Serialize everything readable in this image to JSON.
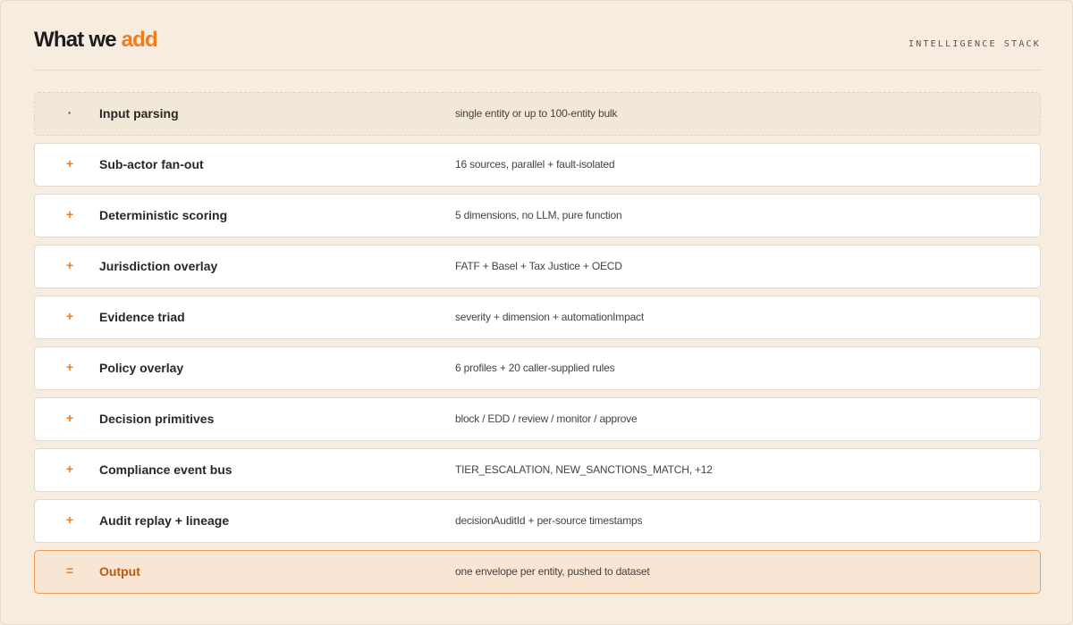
{
  "header": {
    "title_main": "What we",
    "title_accent": "add",
    "kicker": "INTELLIGENCE STACK"
  },
  "colors": {
    "accent": "#f07c1e",
    "background": "#f6ece0",
    "output_text": "#b85a12",
    "output_border": "#ef9a55"
  },
  "rows": [
    {
      "symbol": "·",
      "name": "Input parsing",
      "description": "single entity or up to 100-entity bulk"
    },
    {
      "symbol": "+",
      "name": "Sub-actor fan-out",
      "description": "16 sources, parallel + fault-isolated"
    },
    {
      "symbol": "+",
      "name": "Deterministic scoring",
      "description": "5 dimensions, no LLM, pure function"
    },
    {
      "symbol": "+",
      "name": "Jurisdiction overlay",
      "description": "FATF + Basel + Tax Justice + OECD"
    },
    {
      "symbol": "+",
      "name": "Evidence triad",
      "description": "severity + dimension + automationImpact"
    },
    {
      "symbol": "+",
      "name": "Policy overlay",
      "description": "6 profiles + 20 caller-supplied rules"
    },
    {
      "symbol": "+",
      "name": "Decision primitives",
      "description": "block / EDD / review / monitor / approve"
    },
    {
      "symbol": "+",
      "name": "Compliance event bus",
      "description": "TIER_ESCALATION, NEW_SANCTIONS_MATCH, +12"
    },
    {
      "symbol": "+",
      "name": "Audit replay + lineage",
      "description": "decisionAuditId + per-source timestamps"
    },
    {
      "symbol": "=",
      "name": "Output",
      "description": "one envelope per entity, pushed to dataset"
    }
  ]
}
